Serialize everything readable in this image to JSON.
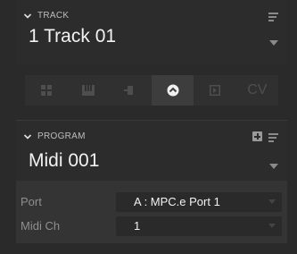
{
  "track": {
    "section_label": "TRACK",
    "name": "1 Track 01"
  },
  "track_types": [
    {
      "icon": "drum-grid-icon",
      "active": false
    },
    {
      "icon": "keygroup-keys-icon",
      "active": false
    },
    {
      "icon": "clip-plug-icon",
      "active": false
    },
    {
      "icon": "midi-port-icon",
      "active": true
    },
    {
      "icon": "audio-track-icon",
      "active": false
    },
    {
      "icon": "cv-text",
      "label": "CV",
      "active": false
    }
  ],
  "program": {
    "section_label": "PROGRAM",
    "name": "Midi 001"
  },
  "settings": {
    "port_label": "Port",
    "port_value": "A : MPC.e Port 1",
    "midi_ch_label": "Midi Ch",
    "midi_ch_value": "1"
  },
  "colors": {
    "background": "#2a2a2a",
    "active_type": "#3d3d3d",
    "text": "#f2f2f2",
    "muted": "#8f8f8f"
  }
}
